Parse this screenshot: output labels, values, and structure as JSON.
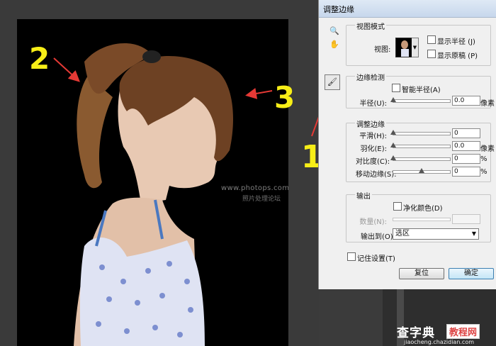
{
  "dialog": {
    "title": "调整边缘",
    "view_mode": {
      "title": "视图模式",
      "view_label": "视图:",
      "show_radius": "显示半径 (J)",
      "show_original": "显示原稿 (P)"
    },
    "edge_detection": {
      "title": "边缘检测",
      "smart_radius": "智能半径(A)",
      "radius_label": "半径(U):",
      "radius_value": "0.0",
      "radius_unit": "像素"
    },
    "adjust_edge": {
      "title": "调整边缘",
      "smooth_label": "平滑(H):",
      "smooth_value": "0",
      "feather_label": "羽化(E):",
      "feather_value": "0.0",
      "feather_unit": "像素",
      "contrast_label": "对比度(C):",
      "contrast_value": "0",
      "contrast_unit": "%",
      "shift_label": "移动边缘(S):",
      "shift_value": "0",
      "shift_unit": "%"
    },
    "output": {
      "title": "输出",
      "decontaminate": "净化颜色(D)",
      "amount_label": "数量(N):",
      "output_to_label": "输出到(O):",
      "output_to_value": "选区"
    },
    "remember": "记住设置(T)",
    "reset_button": "复位",
    "ok_button": "确定"
  },
  "canvas": {
    "watermark_url": "www.photops.com",
    "watermark_cn": "照片处理论坛"
  },
  "annotations": {
    "num1": "1",
    "num2": "2",
    "num3": "3",
    "color": "#f7ee17",
    "arrow_color": "#e53935"
  },
  "footer": {
    "site_cn": "查字典",
    "badge": "教程网",
    "site_url": "jiaocheng.chazidian.com"
  }
}
